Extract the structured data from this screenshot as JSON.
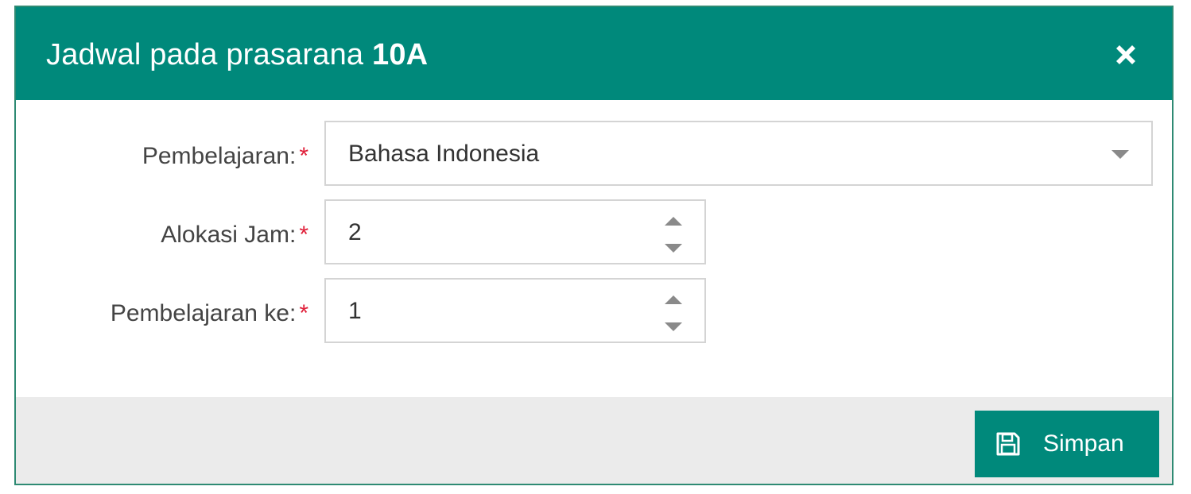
{
  "dialog": {
    "title_prefix": "Jadwal pada prasarana ",
    "title_room": "10A",
    "close_icon": "close-icon"
  },
  "form": {
    "required_mark": "*",
    "pembelajaran": {
      "label": "Pembelajaran:",
      "value": "Bahasa Indonesia"
    },
    "alokasi_jam": {
      "label": "Alokasi Jam:",
      "value": "2"
    },
    "pembelajaran_ke": {
      "label": "Pembelajaran ke:",
      "value": "1"
    }
  },
  "footer": {
    "save_label": "Simpan",
    "save_icon": "save-icon"
  },
  "colors": {
    "primary": "#00897b",
    "required": "#e0203a",
    "footer_bg": "#ebebeb"
  }
}
